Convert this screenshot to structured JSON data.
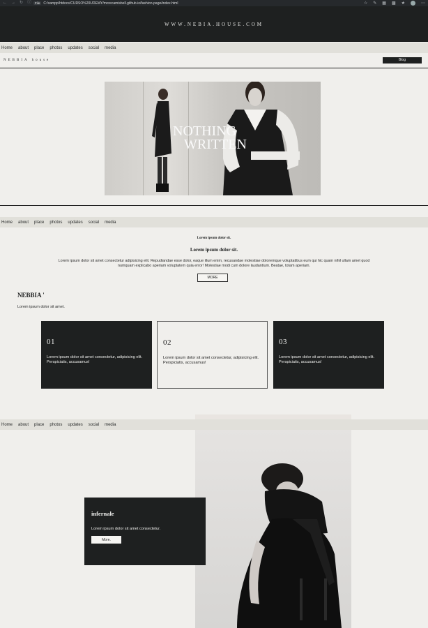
{
  "browser": {
    "file_badge": "File",
    "address": "C:/xampp/htdocs/CURSO%20UDEMY/mcrecamisbell.github.io/fashion-page/index.html"
  },
  "site": {
    "url_title": "WWW.NEBIA.HOUSE.COM",
    "brand": "NEBBIA house",
    "blog_button": "Blog"
  },
  "nav": {
    "items": [
      "Home",
      "about",
      "place",
      "photos",
      "updates",
      "social",
      "media"
    ]
  },
  "hero": {
    "line1": "NOTHING",
    "line2": "WRITTEN"
  },
  "intro": {
    "small_heading": "Lorem ipsum dolor sit.",
    "heading": "Lorem ipsum dolor sit.",
    "paragraph": "Lorem ipsum dolor sit amet consectetur adipisicing elit. Repudiandae esse dolor, eaque illum enim, recusandae molestiae doloremque voluptatibus eum qui hic quam nihil ullam amet quod numquam explicabo aperiam voluptatem quia error! Molestiae modi cum dolore laudantium. Beatae, totam aperiam.",
    "more_button": "MORE"
  },
  "nebbia": {
    "title": "NEBBIA '",
    "subtitle": "Lorem ipsum dolor sit amet."
  },
  "cards": [
    {
      "num": "01",
      "text": "Lorem ipsum dolor sit amet consectetur, adipisicing elit. Perspiciatis, accusamus!"
    },
    {
      "num": "02",
      "text": "Lorem ipsum dolor sit amet consectetur, adipisicing elit. Perspiciatis, accusamus!"
    },
    {
      "num": "03",
      "text": "Lorem ipsum dolor sit amet consectetur, adipisicing elit. Perspiciatis, accusamus!"
    }
  ],
  "infernale": {
    "title": "infernale",
    "text": "Lorem ipsum dolor sit amet consectetur.",
    "button": "More."
  },
  "colors": {
    "dark": "#1e2020",
    "background": "#f0efec",
    "navbar": "#e1e0da"
  }
}
